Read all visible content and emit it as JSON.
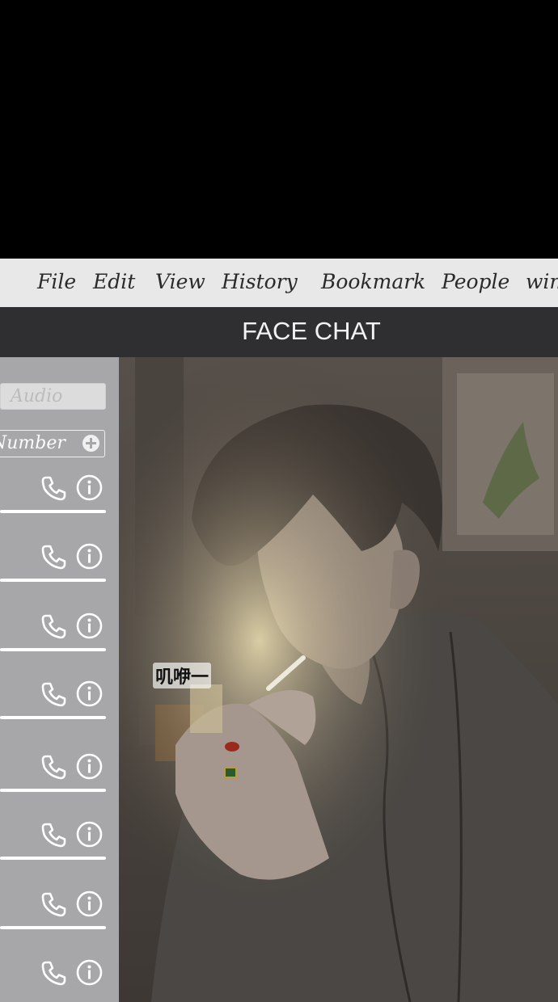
{
  "menubar": {
    "items": [
      "File",
      "Edit",
      "View",
      "History",
      "Bookmark",
      "People",
      "win"
    ]
  },
  "window": {
    "title": "FACE CHAT"
  },
  "sidebar": {
    "audio_placeholder": "Audio",
    "number_label": "Number",
    "contacts": [
      {
        "phone_icon": "phone-icon",
        "info_icon": "info-icon"
      },
      {
        "phone_icon": "phone-icon",
        "info_icon": "info-icon"
      },
      {
        "phone_icon": "phone-icon",
        "info_icon": "info-icon"
      },
      {
        "phone_icon": "phone-icon",
        "info_icon": "info-icon"
      },
      {
        "phone_icon": "phone-icon",
        "info_icon": "info-icon"
      },
      {
        "phone_icon": "phone-icon",
        "info_icon": "info-icon"
      },
      {
        "phone_icon": "phone-icon",
        "info_icon": "info-icon"
      },
      {
        "phone_icon": "phone-icon",
        "info_icon": "info-icon"
      }
    ]
  },
  "video": {
    "caption": "叽咿一"
  },
  "colors": {
    "menubar_bg": "#e9e8e8",
    "titlebar_bg": "#2f2f31",
    "sidebar_bg": "#a7a7a9"
  }
}
